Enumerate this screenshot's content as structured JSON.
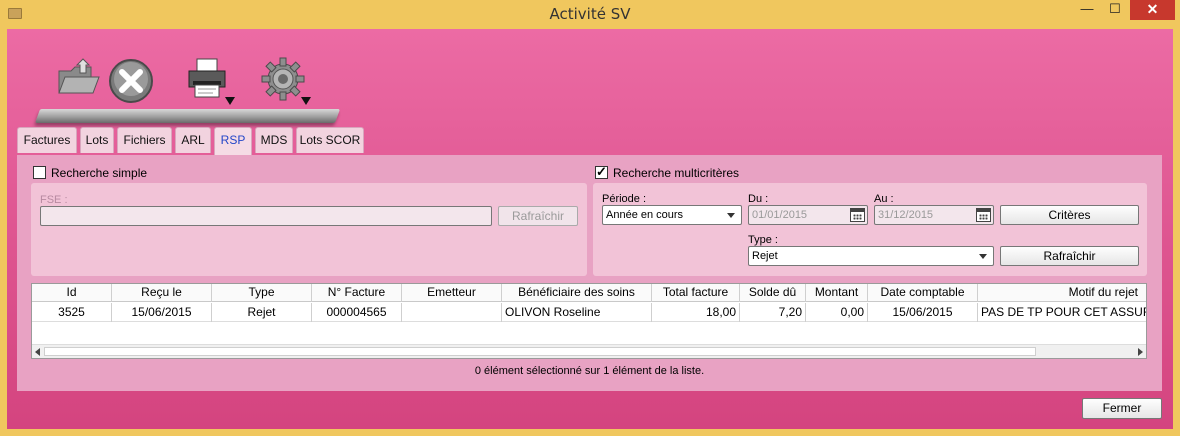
{
  "window": {
    "title": "Activité SV",
    "minimize": "—",
    "maximize": "☐",
    "close": "✕"
  },
  "toolbar": {
    "open_icon": "folder-open-icon",
    "cancel_icon": "cancel-x-icon",
    "print_icon": "printer-icon",
    "settings_icon": "gear-icon"
  },
  "tabs": [
    {
      "label": "Factures",
      "active": false
    },
    {
      "label": "Lots",
      "active": false
    },
    {
      "label": "Fichiers",
      "active": false
    },
    {
      "label": "ARL",
      "active": false
    },
    {
      "label": "RSP",
      "active": true
    },
    {
      "label": "MDS",
      "active": false
    },
    {
      "label": "Lots SCOR",
      "active": false
    }
  ],
  "simple_search": {
    "checkbox_label": "Recherche simple",
    "checked": false,
    "fse_label": "FSE :",
    "fse_value": "",
    "refresh_label": "Rafraîchir"
  },
  "multi_search": {
    "checkbox_label": "Recherche multicritères",
    "checked": true,
    "period_label": "Période :",
    "period_value": "Année en cours",
    "from_label": "Du :",
    "from_value": "01/01/2015",
    "to_label": "Au :",
    "to_value": "31/12/2015",
    "criteria_label": "Critères",
    "type_label": "Type :",
    "type_value": "Rejet",
    "refresh_label": "Rafraîchir"
  },
  "grid": {
    "columns": [
      "Id",
      "Reçu le",
      "Type",
      "N° Facture",
      "Emetteur",
      "Bénéficiaire des soins",
      "Total facture",
      "Solde dû",
      "Montant",
      "Date comptable",
      "Motif du rejet"
    ],
    "rows": [
      [
        "3525",
        "15/06/2015",
        "Rejet",
        "000004565",
        "",
        "OLIVON Roseline",
        "18,00",
        "7,20",
        "0,00",
        "15/06/2015",
        "PAS DE TP POUR CET ASSURE"
      ]
    ]
  },
  "status_text": "0 élément sélectionné sur 1 élément de la liste.",
  "close_button_label": "Fermer",
  "colors": {
    "accent": "#e05893",
    "title_bar": "#f0c75e",
    "active_tab_text": "#2346c8"
  }
}
